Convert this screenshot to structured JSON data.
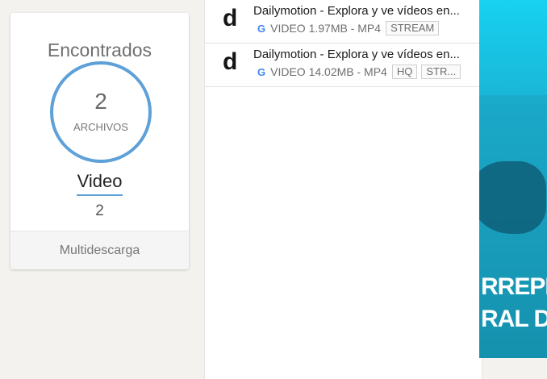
{
  "summary": {
    "title": "Encontrados",
    "count": "2",
    "count_label": "ARCHIVOS",
    "category_label": "Video",
    "category_count": "2",
    "footer_button": "Multidescarga"
  },
  "results": [
    {
      "icon": "d",
      "title": "Dailymotion - Explora y ve vídeos en...",
      "source_icon": "G",
      "meta": "VIDEO 1.97MB - MP4",
      "tags": [
        "STREAM"
      ]
    },
    {
      "icon": "d",
      "title": "Dailymotion - Explora y ve vídeos en...",
      "source_icon": "G",
      "meta": "VIDEO 14.02MB - MP4",
      "tags": [
        "HQ",
        "STR..."
      ]
    }
  ],
  "thumbnail": {
    "line1": "RREPET",
    "line2": "RAL DE"
  },
  "colors": {
    "accent": "#5ea1d8",
    "thumbnail": "#1aa8c8"
  }
}
